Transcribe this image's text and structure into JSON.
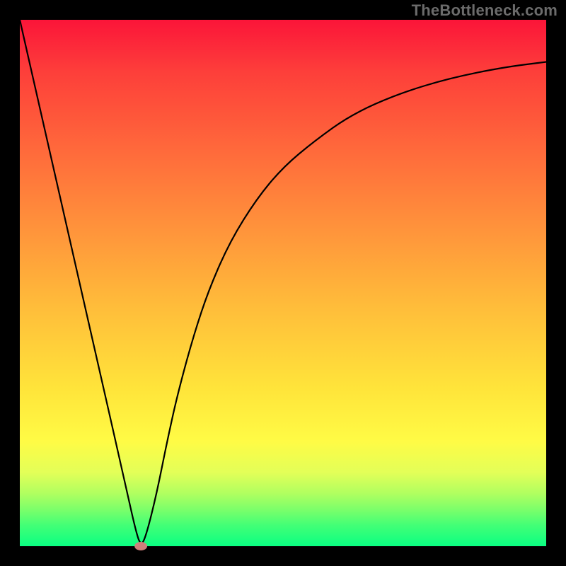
{
  "watermark": "TheBottleneck.com",
  "chart_data": {
    "type": "line",
    "title": "",
    "xlabel": "",
    "ylabel": "",
    "xlim": [
      0,
      100
    ],
    "ylim": [
      0,
      100
    ],
    "grid": false,
    "legend": false,
    "background_gradient": {
      "direction": "vertical",
      "stops": [
        {
          "pos": 0,
          "color": "#fb1539"
        },
        {
          "pos": 25,
          "color": "#ff6a3b"
        },
        {
          "pos": 55,
          "color": "#ffbe3a"
        },
        {
          "pos": 80,
          "color": "#fffb45"
        },
        {
          "pos": 100,
          "color": "#0aff82"
        }
      ]
    },
    "series": [
      {
        "name": "curve",
        "x": [
          0,
          5,
          10,
          15,
          20,
          22,
          23,
          24,
          26,
          28,
          30,
          33,
          36,
          40,
          45,
          50,
          56,
          63,
          72,
          82,
          92,
          100
        ],
        "y": [
          100,
          78,
          56,
          34,
          12,
          3,
          0,
          2,
          10,
          20,
          29,
          40,
          49,
          58,
          66,
          72,
          77,
          82,
          86,
          89,
          91,
          92
        ]
      }
    ],
    "marker": {
      "x": 23,
      "y": 0,
      "rx": 1.2,
      "ry": 0.8,
      "color": "#cf7f7b"
    }
  }
}
